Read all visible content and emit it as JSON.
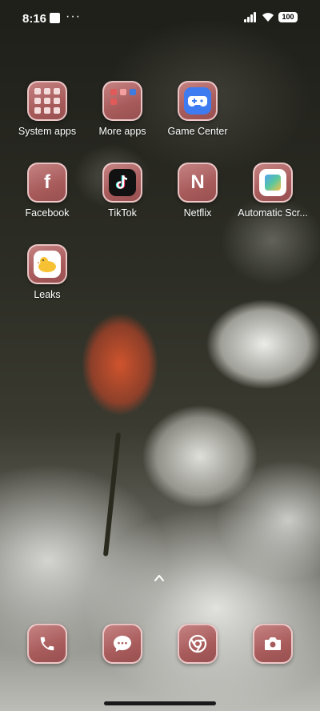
{
  "status_bar": {
    "time": "8:16",
    "overflow": "···",
    "battery": "100"
  },
  "apps": {
    "system_apps": "System apps",
    "more_apps": "More apps",
    "game_center": "Game Center",
    "facebook": "Facebook",
    "facebook_glyph": "f",
    "tiktok": "TikTok",
    "netflix": "Netflix",
    "netflix_glyph": "N",
    "automatic_scr": "Automatic Scr...",
    "leaks": "Leaks"
  },
  "dock": {
    "items": [
      "phone-icon",
      "messages-icon",
      "chrome-icon",
      "camera-icon"
    ]
  },
  "colors": {
    "tile_gradient_top": "#c58282",
    "tile_gradient_bottom": "#985050",
    "gamecenter_blue": "#3e7bf0",
    "leaks_yellow": "#f6c233"
  }
}
